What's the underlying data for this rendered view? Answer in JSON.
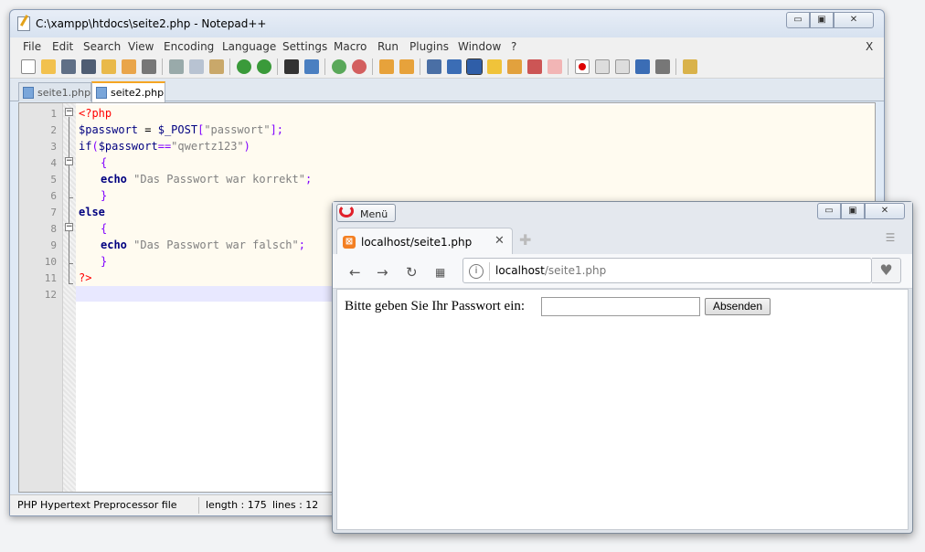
{
  "notepad": {
    "title": "C:\\xampp\\htdocs\\seite2.php - Notepad++",
    "window_buttons": {
      "minimize": "▭",
      "maximize": "▣",
      "close": "✕"
    },
    "menu": [
      "File",
      "Edit",
      "Search",
      "View",
      "Encoding",
      "Language",
      "Settings",
      "Macro",
      "Run",
      "Plugins",
      "Window",
      "?"
    ],
    "menu_close": "X",
    "tabs": [
      {
        "label": "seite1.php",
        "active": false
      },
      {
        "label": "seite2.php",
        "active": true
      }
    ],
    "line_numbers": [
      "1",
      "2",
      "3",
      "4",
      "5",
      "6",
      "7",
      "8",
      "9",
      "10",
      "11",
      "12"
    ],
    "code": {
      "l1": "<?php",
      "l2_var": "$passwort",
      "l2_mid": " = ",
      "l2_post": "$_POST",
      "l2_open": "[",
      "l2_str": "\"passwort\"",
      "l2_close": "];",
      "l3_if": "if",
      "l3_open": "(",
      "l3_var": "$passwort",
      "l3_op": "==",
      "l3_str": "\"qwertz123\"",
      "l3_close": ")",
      "l4": "{",
      "l5_echo": "echo",
      "l5_str": " \"Das Passwort war korrekt\"",
      "l5_end": ";",
      "l6": "}",
      "l7": "else",
      "l8": "{",
      "l9_echo": "echo",
      "l9_str": " \"Das Passwort war falsch\"",
      "l9_end": ";",
      "l10": "}",
      "l11": "?>"
    },
    "status": {
      "filetype": "PHP Hypertext Preprocessor file",
      "length": "length : 175",
      "lines": "lines : 12"
    }
  },
  "browser": {
    "menu_label": "Menü",
    "window_buttons": {
      "minimize": "▭",
      "maximize": "▣",
      "close": "✕"
    },
    "tab_label": "localhost/seite1.php",
    "tab_close": "✕",
    "new_tab": "✚",
    "url_host": "localhost",
    "url_path": "/seite1.php",
    "page": {
      "prompt": "Bitte geben Sie Ihr Passwort ein:",
      "password_value": "",
      "submit_label": "Absenden"
    }
  }
}
